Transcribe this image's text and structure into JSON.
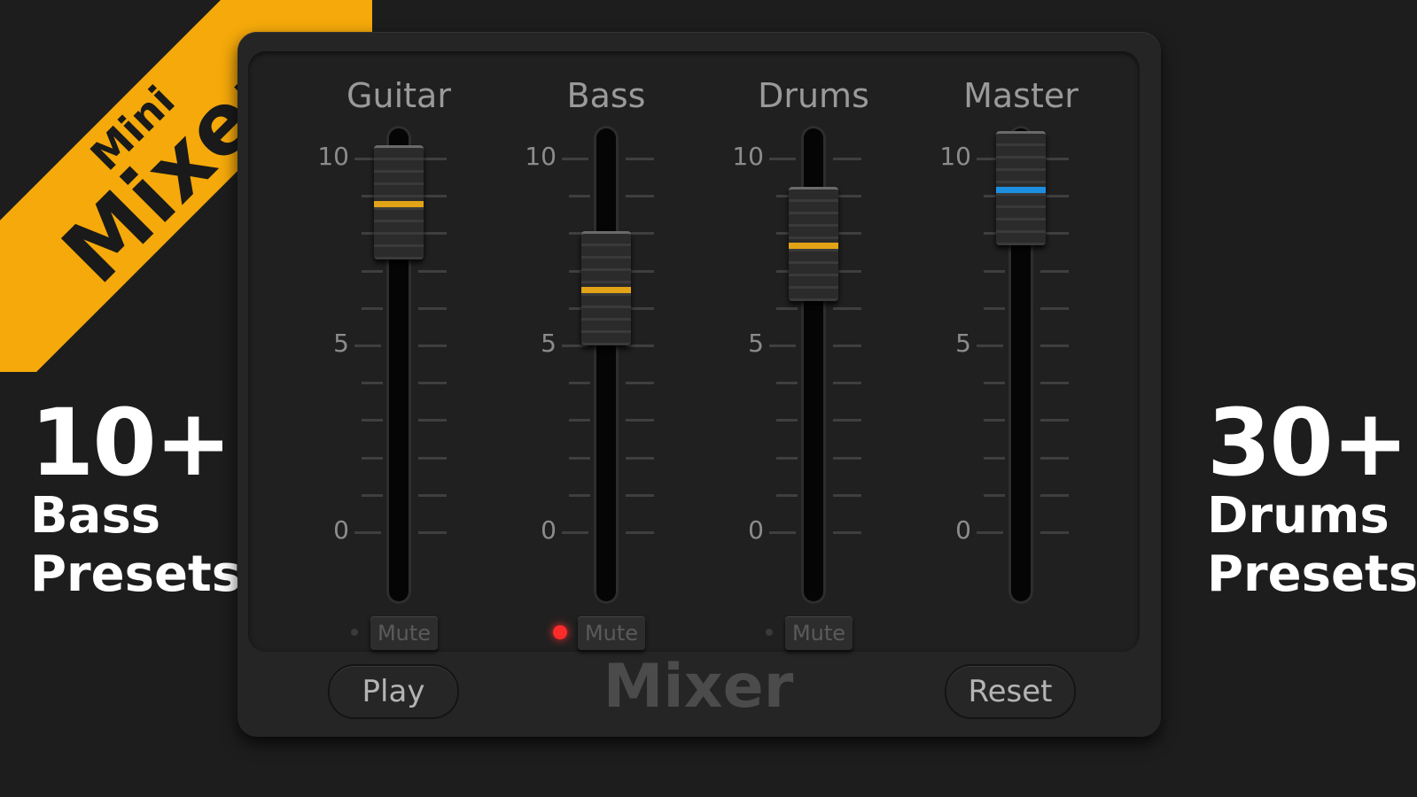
{
  "ribbon": {
    "line1": "Mini",
    "line2": "Mixer",
    "color": "#f5a90a"
  },
  "left_stat": {
    "number": "10+",
    "line1": "Bass",
    "line2": "Presets"
  },
  "right_stat": {
    "number": "30+",
    "line1": "Drums",
    "line2": "Presets"
  },
  "scale_labels": {
    "top": "10",
    "mid": "5",
    "bottom": "0"
  },
  "channels": [
    {
      "label": "Guitar",
      "level": 0.89,
      "indicator_color": "#e2a316",
      "mute_label": "Mute",
      "mute_led": "off",
      "has_mute": true
    },
    {
      "label": "Bass",
      "level": 0.66,
      "indicator_color": "#e2a316",
      "mute_label": "Mute",
      "mute_led": "on",
      "has_mute": true
    },
    {
      "label": "Drums",
      "level": 0.78,
      "indicator_color": "#e2a316",
      "mute_label": "Mute",
      "mute_led": "off",
      "has_mute": true
    },
    {
      "label": "Master",
      "level": 0.93,
      "indicator_color": "#1d8fe0",
      "has_mute": false
    }
  ],
  "footer": {
    "play_label": "Play",
    "title": "Mixer",
    "reset_label": "Reset"
  }
}
